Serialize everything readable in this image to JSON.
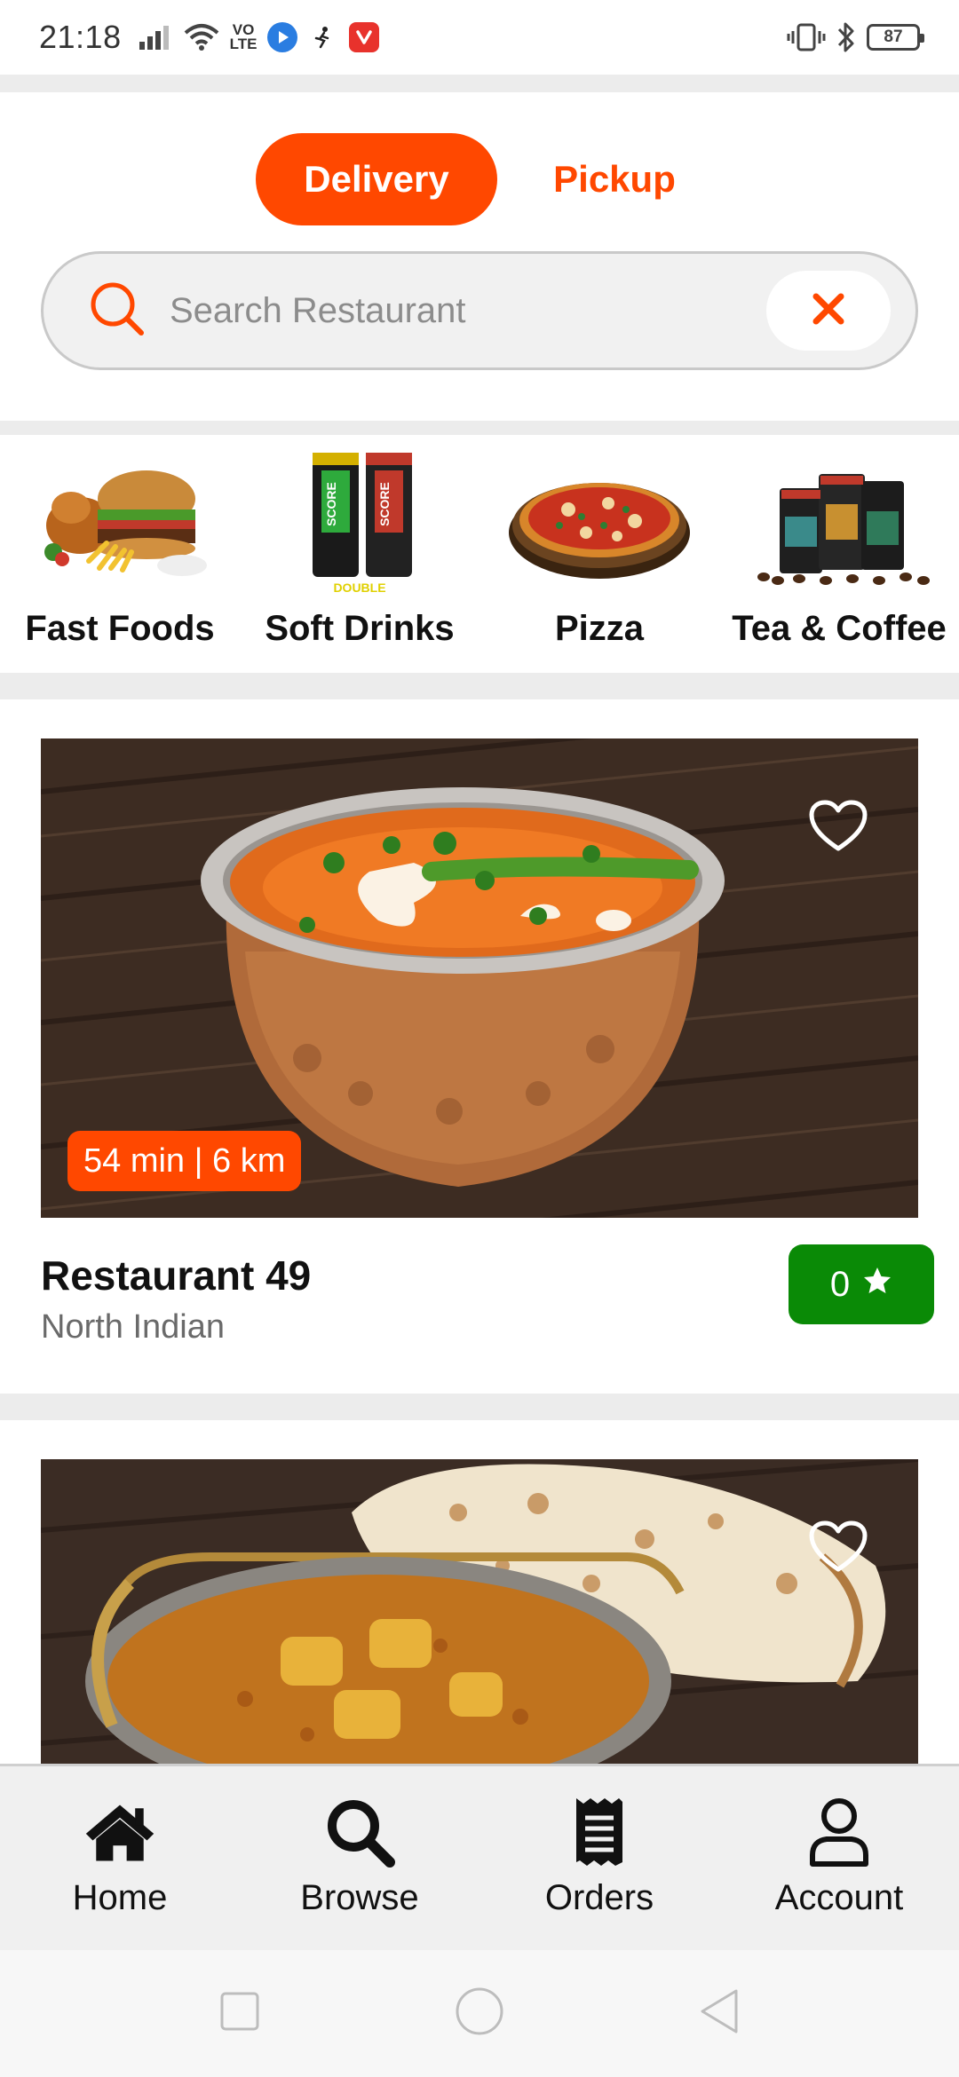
{
  "status_bar": {
    "time": "21:18",
    "volte_top": "VO",
    "volte_bottom": "LTE",
    "battery": "87",
    "icons": [
      "signal-icon",
      "wifi-icon",
      "volte-icon",
      "play-app-icon",
      "running-app-icon",
      "vivaldi-app-icon",
      "vibrate-icon",
      "bluetooth-icon",
      "battery-icon"
    ]
  },
  "mode_tabs": {
    "delivery": "Delivery",
    "pickup": "Pickup",
    "active": "delivery"
  },
  "search": {
    "placeholder": "Search Restaurant",
    "value": ""
  },
  "categories": [
    {
      "label": "Fast Foods"
    },
    {
      "label": "Soft Drinks"
    },
    {
      "label": "Pizza"
    },
    {
      "label": "Tea & Coffee"
    }
  ],
  "category_image_text": {
    "drink_brand": "SCORE",
    "drink_tag": "DOUBLE"
  },
  "restaurants": [
    {
      "name": "Restaurant 49",
      "cuisine": "North Indian",
      "eta": "54 min | 6 km",
      "rating": "0",
      "favorite": false
    },
    {
      "name": "",
      "cuisine": "",
      "eta": "",
      "rating": "",
      "favorite": false
    }
  ],
  "bottom_nav": [
    {
      "label": "Home",
      "icon": "home-icon"
    },
    {
      "label": "Browse",
      "icon": "search-icon"
    },
    {
      "label": "Orders",
      "icon": "receipt-icon"
    },
    {
      "label": "Account",
      "icon": "user-icon"
    }
  ],
  "colors": {
    "accent": "#FF4800",
    "rating_green": "#0A8A06"
  }
}
